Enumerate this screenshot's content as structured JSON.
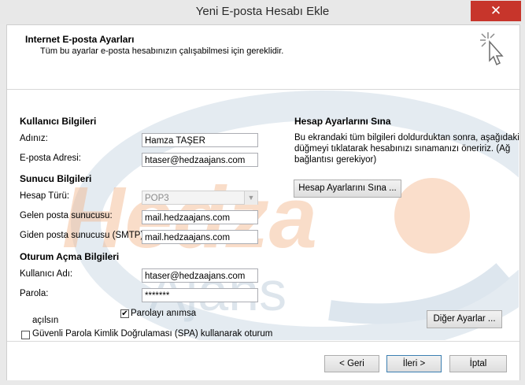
{
  "window": {
    "title": "Yeni E-posta Hesabı Ekle",
    "close_glyph": "✕"
  },
  "header": {
    "title": "Internet E-posta Ayarları",
    "subtitle": "Tüm bu ayarlar e-posta hesabınızın çalışabilmesi için gereklidir."
  },
  "user_info": {
    "heading": "Kullanıcı Bilgileri",
    "name_label": "Adınız:",
    "name_value": "Hamza TAŞER",
    "email_label": "E-posta Adresi:",
    "email_value": "htaser@hedzaajans.com"
  },
  "server_info": {
    "heading": "Sunucu Bilgileri",
    "account_type_label": "Hesap Türü:",
    "account_type_value": "POP3",
    "incoming_label": "Gelen posta sunucusu:",
    "incoming_value": "mail.hedzaajans.com",
    "outgoing_label": "Giden posta sunucusu (SMTP):",
    "outgoing_value": "mail.hedzaajans.com"
  },
  "logon_info": {
    "heading": "Oturum Açma Bilgileri",
    "username_label": "Kullanıcı Adı:",
    "username_value": "htaser@hedzaajans.com",
    "password_label": "Parola:",
    "password_value": "*******",
    "remember_label": "Parolayı anımsa",
    "remember_checked": true,
    "spa_label_line1": "Güvenli Parola Kimlik Doğrulaması (SPA) kullanarak oturum",
    "spa_label_line2": "açılsın",
    "spa_checked": false
  },
  "test_settings": {
    "heading": "Hesap Ayarlarını Sına",
    "desc_line1": "Bu ekrandaki tüm bilgileri doldurduktan sonra, aşağıdaki",
    "desc_line2": "düğmeyi tıklatarak hesabınızı sınamanızı öneririz. (Ağ",
    "desc_line3": "bağlantısı gerekiyor)",
    "test_button": "Hesap Ayarlarını Sına ...",
    "more_settings_button": "Diğer Ayarlar ..."
  },
  "footer": {
    "back_button": "< Geri",
    "next_button": "İleri >",
    "cancel_button": "İptal"
  },
  "watermark": {
    "text_top": "Hedza",
    "text_bottom": "Ajans"
  },
  "colors": {
    "accent_blue": "#3c7fb1",
    "close_red": "#c7352b",
    "watermark_orange": "#f08a45",
    "watermark_blue": "#9fb8cf"
  }
}
